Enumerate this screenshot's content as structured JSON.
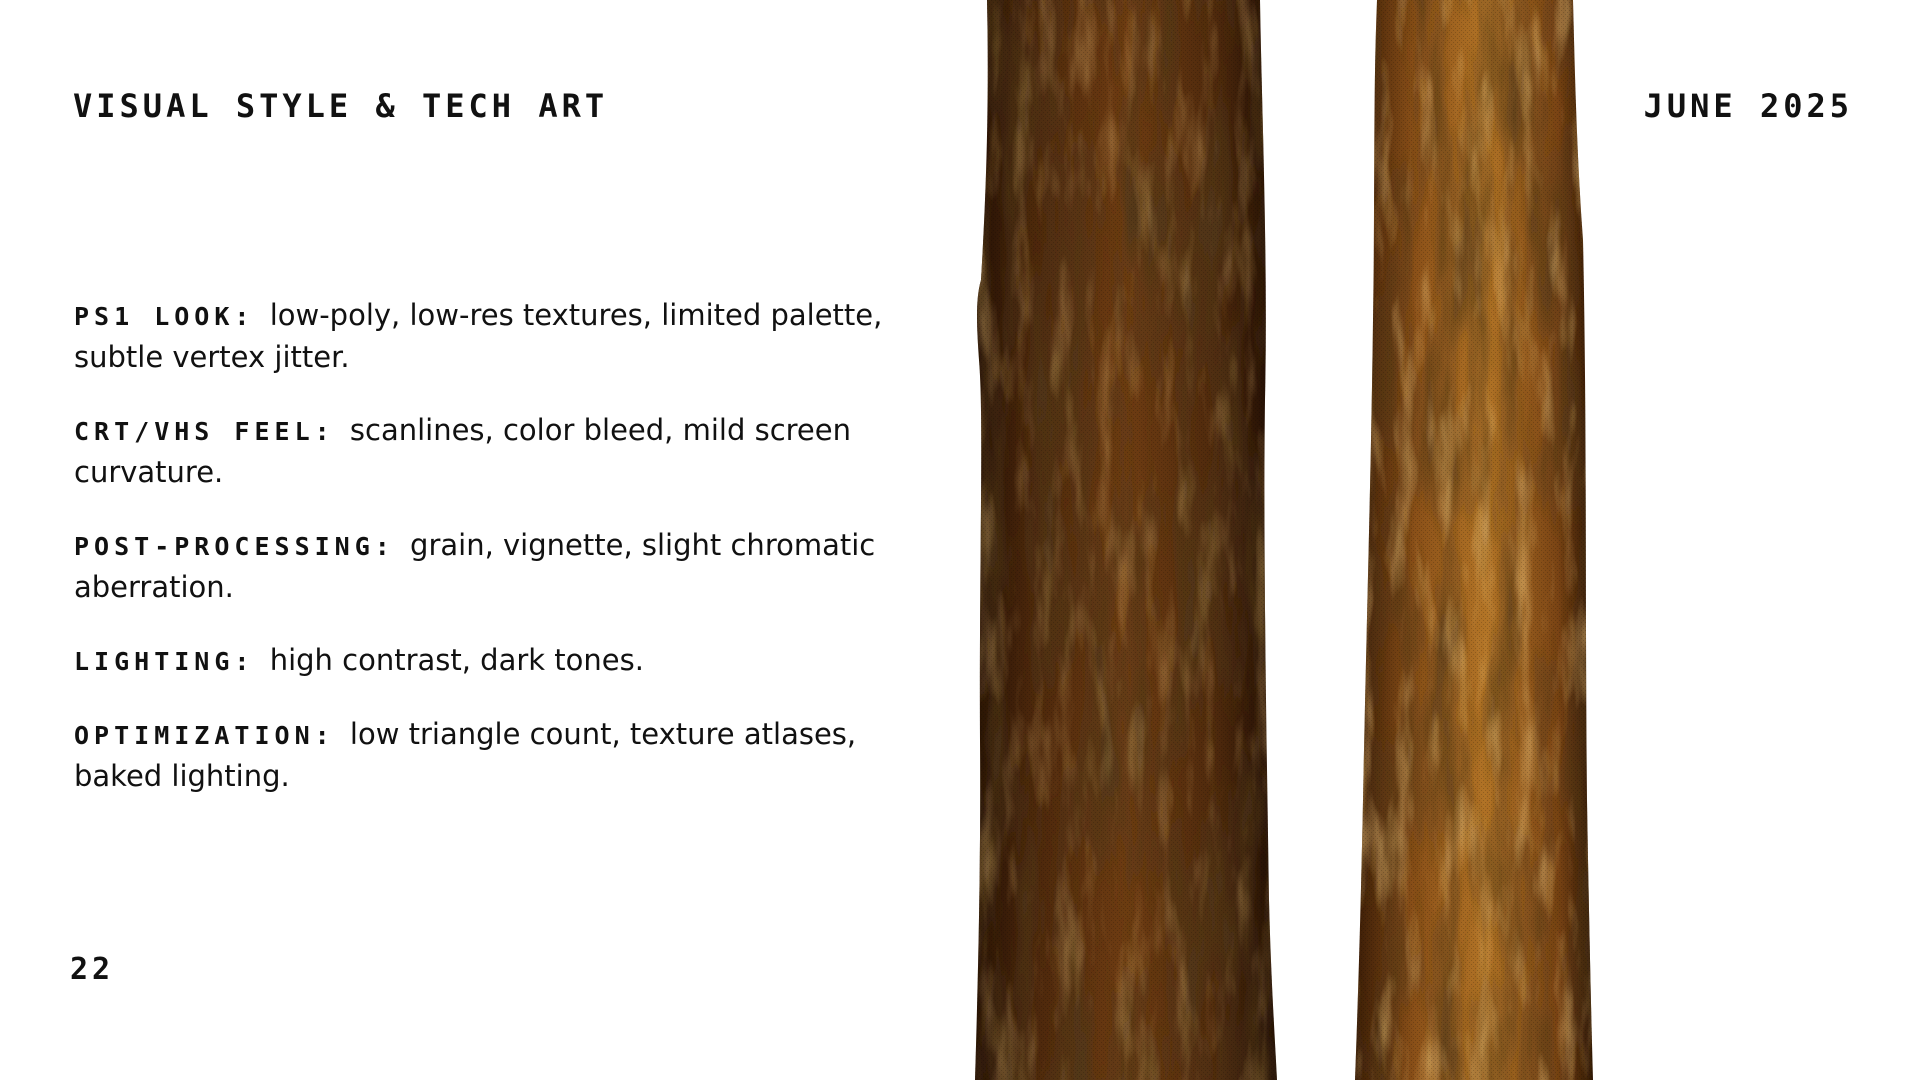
{
  "header": {
    "title": "VISUAL STYLE & TECH ART",
    "date": "JUNE 2025"
  },
  "items": [
    {
      "label": "PS1 LOOK:",
      "text": "low-poly, low-res textures, limited palette, subtle vertex jitter."
    },
    {
      "label": "CRT/VHS FEEL:",
      "text": "scanlines, color bleed, mild screen curvature."
    },
    {
      "label": "POST-PROCESSING:",
      "text": "grain, vignette, slight chromatic aberration."
    },
    {
      "label": "LIGHTING:",
      "text": "high contrast, dark tones."
    },
    {
      "label": "OPTIMIZATION:",
      "text": "low triangle count, texture atlases, baked lighting."
    }
  ],
  "footer": {
    "page_number": "22"
  },
  "colors": {
    "text": "#111111",
    "background": "#ffffff",
    "bark_dark": "#3a1e0a",
    "bark_mid": "#7a4416",
    "bark_light": "#b27426"
  }
}
